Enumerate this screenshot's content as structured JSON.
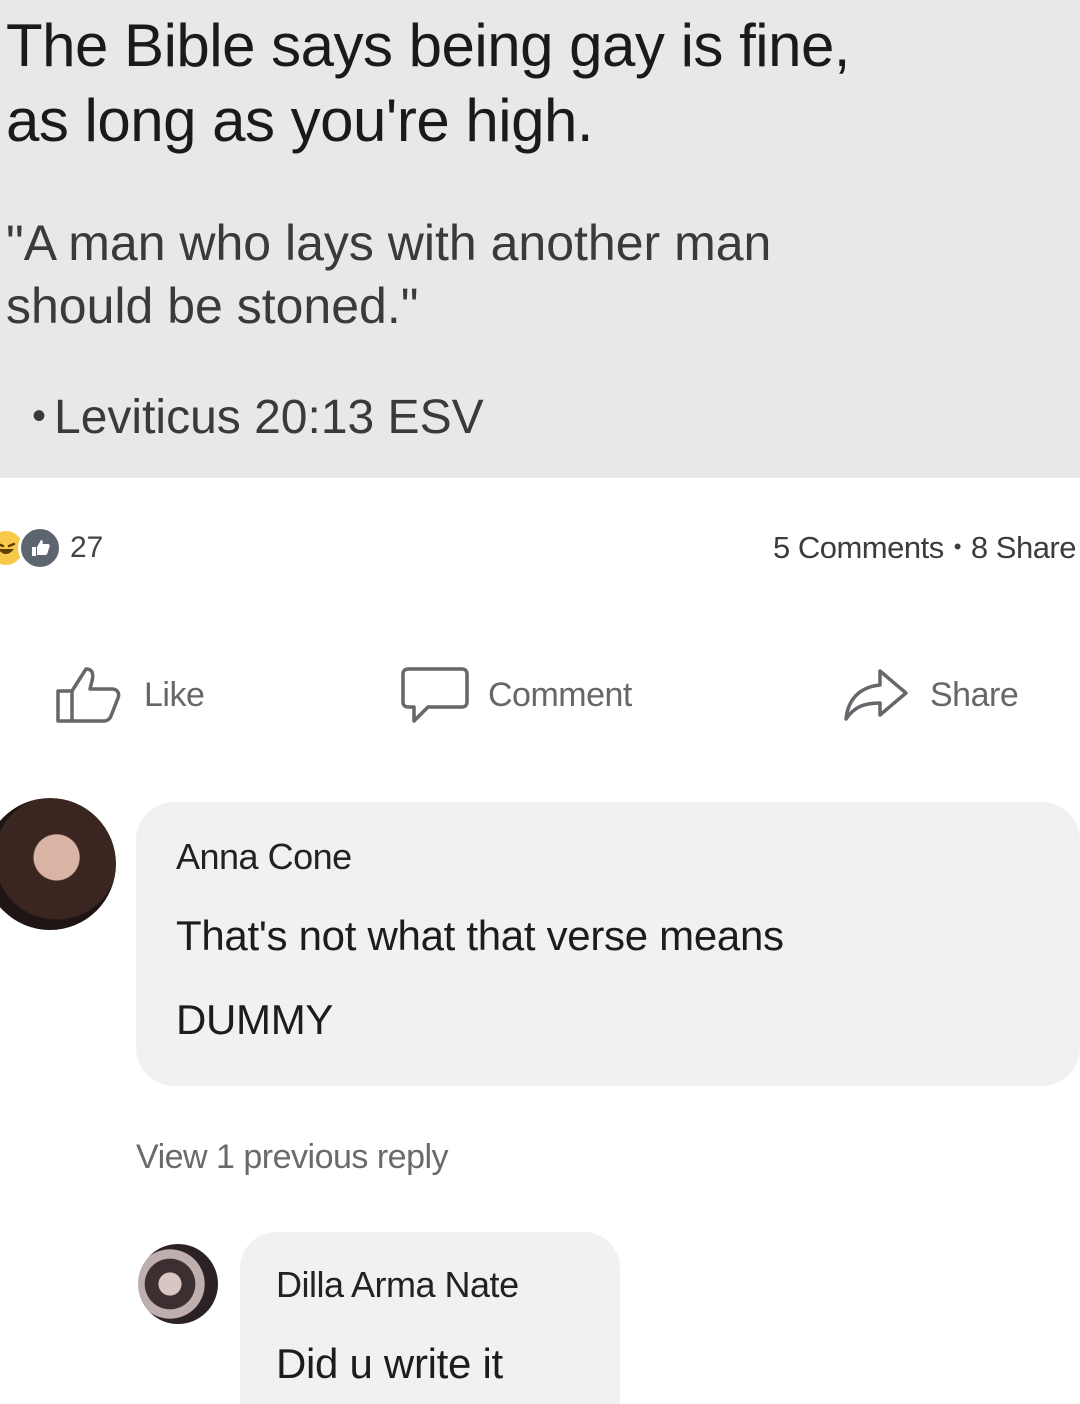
{
  "post": {
    "headline": [
      "The Bible says being gay is fine,",
      "as long as you're high."
    ],
    "quote": [
      "\"A man who lays with another man",
      "should be stoned.\""
    ],
    "citation_bullet": "•",
    "citation": "Leviticus 20:13 ESV"
  },
  "stats": {
    "reaction_count": "27",
    "comments": "5 Comments",
    "separator": "•",
    "shares": "8 Share"
  },
  "actions": {
    "like": "Like",
    "comment": "Comment",
    "share": "Share"
  },
  "comments": [
    {
      "name": "Anna Cone",
      "lines": [
        "That's not what that verse means",
        "DUMMY"
      ]
    }
  ],
  "view_replies": "View 1 previous reply",
  "replies": [
    {
      "name": "Dilla Arma Nate",
      "text": "Did u write it"
    }
  ],
  "colors": {
    "post_background": "#e9e7ea",
    "bubble": "#f1f1f4",
    "muted_text": "#65676b",
    "haha_reaction": "#f7c94b",
    "like_reaction": "#5d6570"
  },
  "icons": [
    "haha-reaction-icon",
    "like-reaction-icon",
    "thumbs-up-icon",
    "comment-bubble-icon",
    "share-arrow-icon"
  ]
}
